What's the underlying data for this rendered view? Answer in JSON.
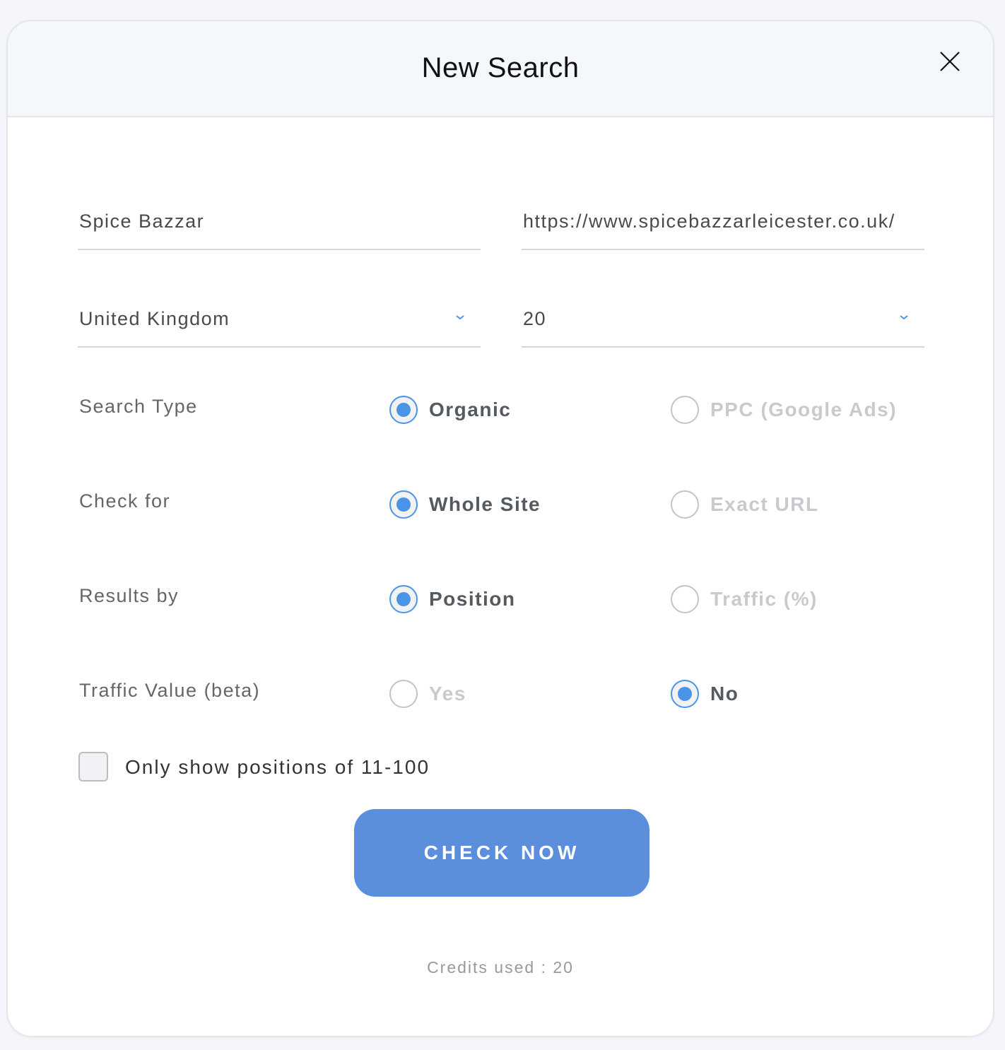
{
  "modal": {
    "title": "New Search",
    "close_icon": "close-icon"
  },
  "form": {
    "name_value": "Spice Bazzar",
    "url_value": "https://www.spicebazzarleicester.co.uk/",
    "country_value": "United Kingdom",
    "count_value": "20",
    "search_type": {
      "label": "Search Type",
      "options": [
        {
          "label": "Organic",
          "checked": true
        },
        {
          "label": "PPC (Google Ads)",
          "checked": false
        }
      ]
    },
    "check_for": {
      "label": "Check for",
      "options": [
        {
          "label": "Whole Site",
          "checked": true
        },
        {
          "label": "Exact URL",
          "checked": false
        }
      ]
    },
    "results_by": {
      "label": "Results by",
      "options": [
        {
          "label": "Position",
          "checked": true
        },
        {
          "label": "Traffic (%)",
          "checked": false
        }
      ]
    },
    "traffic_value": {
      "label": "Traffic Value (beta)",
      "options": [
        {
          "label": "Yes",
          "checked": false
        },
        {
          "label": "No",
          "checked": true
        }
      ]
    },
    "only_positions_label": "Only show positions of 11-100",
    "only_positions_checked": false,
    "submit_label": "CHECK NOW",
    "credits_text": "Credits used : 20"
  },
  "colors": {
    "accent": "#4a94e8",
    "button": "#5b8fdb",
    "header_bg": "#f4f7fc"
  }
}
